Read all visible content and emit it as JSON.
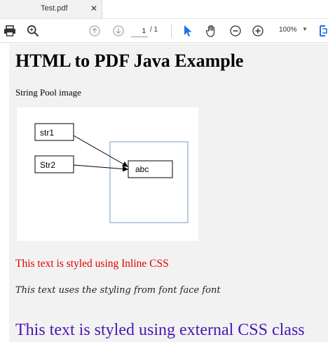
{
  "tab": {
    "title": "Test.pdf",
    "close_glyph": "✕"
  },
  "toolbar": {
    "print_icon": "print-icon",
    "search_icon": "search-icon",
    "prev_icon": "arrow-up-circle-icon",
    "next_icon": "arrow-down-circle-icon",
    "page_current": "1",
    "page_total": "/ 1",
    "select_icon": "cursor-icon",
    "hand_icon": "hand-icon",
    "zoom_out_icon": "zoom-out-icon",
    "zoom_in_icon": "zoom-in-icon",
    "zoom": "100%",
    "fit_icon": "fit-page-icon",
    "accent_color": "#1a73e8"
  },
  "document": {
    "title": "HTML to PDF Java Example",
    "caption": "String Pool image",
    "figure": {
      "labels": [
        "str1",
        "Str2",
        "abc"
      ]
    },
    "inline_text": "This text is styled using Inline CSS",
    "inline_color": "#e00000",
    "fontface_text": "This text uses the styling from font face font",
    "external_text": "This text is styled using external CSS class",
    "external_color": "#4b16b3"
  }
}
